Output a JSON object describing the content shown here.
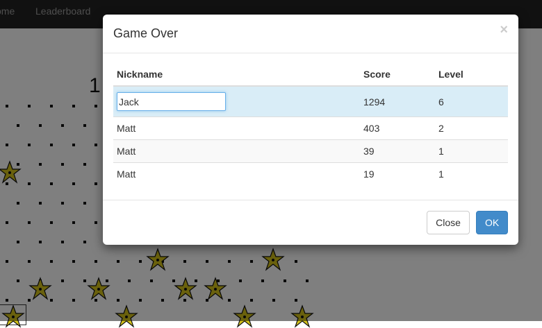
{
  "navbar": {
    "home_label": "ome",
    "leaderboard_label": "Leaderboard"
  },
  "game": {
    "score_partial": "1"
  },
  "modal": {
    "title": "Game Over",
    "close_symbol": "×",
    "columns": [
      "Nickname",
      "Score",
      "Level"
    ],
    "current_entry": {
      "nickname": "Jack",
      "score": "1294",
      "level": "6"
    },
    "rows": [
      {
        "nickname": "Matt",
        "score": "403",
        "level": "2"
      },
      {
        "nickname": "Matt",
        "score": "39",
        "level": "1"
      },
      {
        "nickname": "Matt",
        "score": "19",
        "level": "1"
      }
    ],
    "close_button_label": "Close",
    "ok_button_label": "OK"
  },
  "colors": {
    "navbar": "#222222",
    "primary": "#428bca",
    "highlight_row": "#d9edf7",
    "star_fill": "#d4c21a"
  }
}
